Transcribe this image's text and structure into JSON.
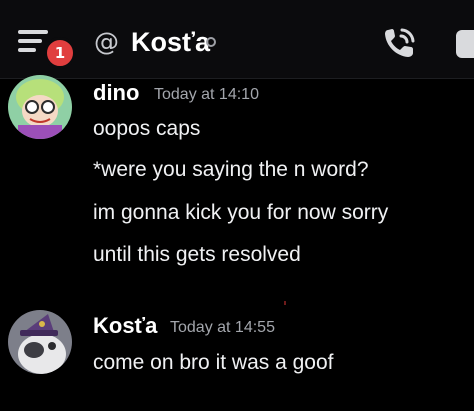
{
  "header": {
    "menu_badge": "1",
    "at_symbol": "@",
    "channel_name": "Kosťa",
    "icons": {
      "menu": "hamburger-menu-icon",
      "call": "voice-call-icon",
      "right": "member-list-icon"
    }
  },
  "messages": [
    {
      "author": "dino",
      "timestamp": "Today at 14:10",
      "avatar": "dino-avatar-icon",
      "lines": [
        "oopos caps",
        "*were you saying the n word?",
        "im gonna kick you for now sorry",
        "until this gets resolved"
      ]
    },
    {
      "author": "Kosťa",
      "timestamp": "Today at 14:55",
      "avatar": "kosta-avatar-icon",
      "lines": [
        "come on bro it was a goof"
      ]
    }
  ],
  "colors": {
    "background": "#000000",
    "header": "#0b0b0d",
    "badge": "#e03e3e",
    "timestamp": "#a3a6ac",
    "text": "#f0f1f3"
  }
}
